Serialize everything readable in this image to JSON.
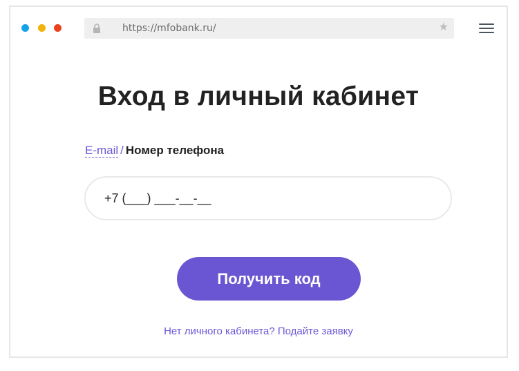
{
  "browser": {
    "url": "https://mfobank.ru/",
    "dots": [
      {
        "name": "blue",
        "color": "#15a3e8"
      },
      {
        "name": "yellow",
        "color": "#f1b20e"
      },
      {
        "name": "red",
        "color": "#e8431e"
      }
    ]
  },
  "page": {
    "title": "Вход в личный кабинет",
    "switch": {
      "email_label": "E-mail",
      "separator": "/",
      "phone_label": "Номер телефона"
    },
    "phone_input": {
      "value": "+7 (___) ___-__-__"
    },
    "submit_label": "Получить код",
    "apply_link": "Нет личного кабинета? Подайте заявку"
  },
  "colors": {
    "accent": "#6a56d2",
    "link": "#6d57d6",
    "text": "#222222"
  }
}
